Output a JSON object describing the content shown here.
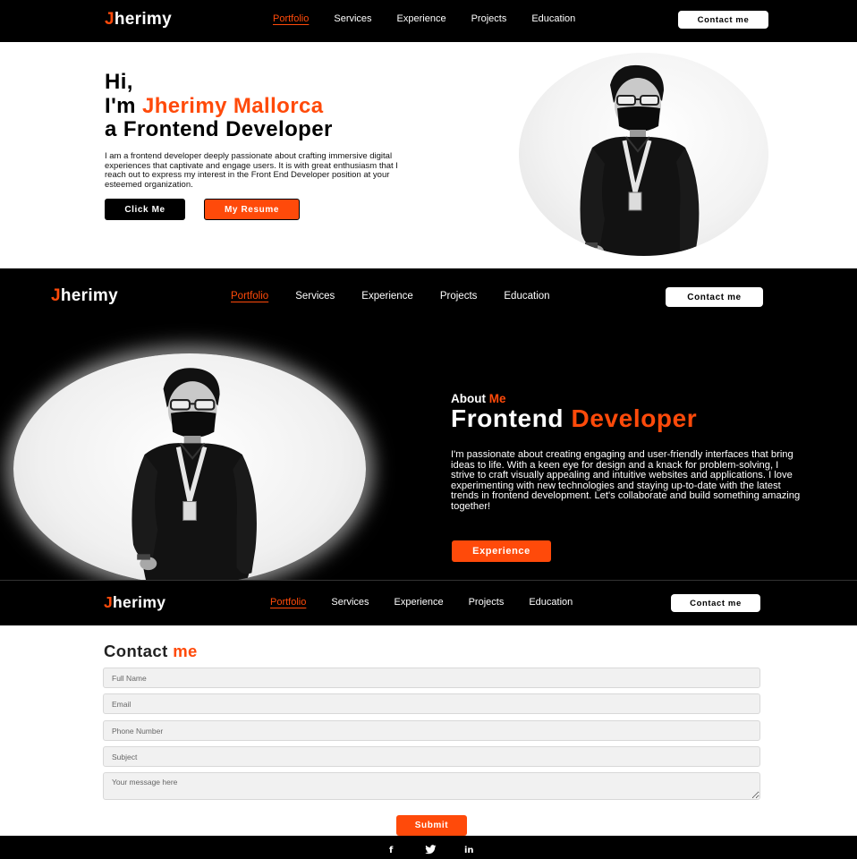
{
  "brand": {
    "initial": "J",
    "rest": "herimy",
    "accent_color": "#ff4a0a"
  },
  "nav": {
    "links": [
      "Portfolio",
      "Services",
      "Experience",
      "Projects",
      "Education"
    ],
    "active": "Portfolio",
    "cta": "Contact me"
  },
  "hero": {
    "line1": "Hi,",
    "line2_prefix": "I'm ",
    "name": "Jherimy Mallorca",
    "line3": "a Frontend Developer",
    "description": "I am a frontend developer deeply passionate about crafting immersive digital experiences that captivate and engage users. It is with great enthusiasm that I reach out to express my interest in the Front End Developer position at your esteemed organization.",
    "primary_button": "Click Me",
    "secondary_button": "My Resume"
  },
  "about": {
    "kicker_prefix": "About ",
    "kicker_accent": "Me",
    "title_prefix": "Frontend ",
    "title_accent": "Developer",
    "text": "I'm passionate about creating engaging and user-friendly interfaces that bring ideas to life. With a keen eye for design and a knack for problem-solving, I strive to craft visually appealing and intuitive websites and applications. I love experimenting with new technologies and staying up-to-date with the latest trends in frontend development. Let's collaborate and build something amazing together!",
    "button": "Experience"
  },
  "contact": {
    "title_prefix": "Contact ",
    "title_accent": "me",
    "placeholders": {
      "name": "Full Name",
      "email": "Email",
      "phone": "Phone Number",
      "subject": "Subject",
      "message": "Your message here"
    },
    "submit": "Submit"
  },
  "footer": {
    "social_icons": [
      "facebook-icon",
      "twitter-icon",
      "linkedin-icon"
    ],
    "facebook_glyph": "f",
    "linkedin_glyph": "in"
  }
}
